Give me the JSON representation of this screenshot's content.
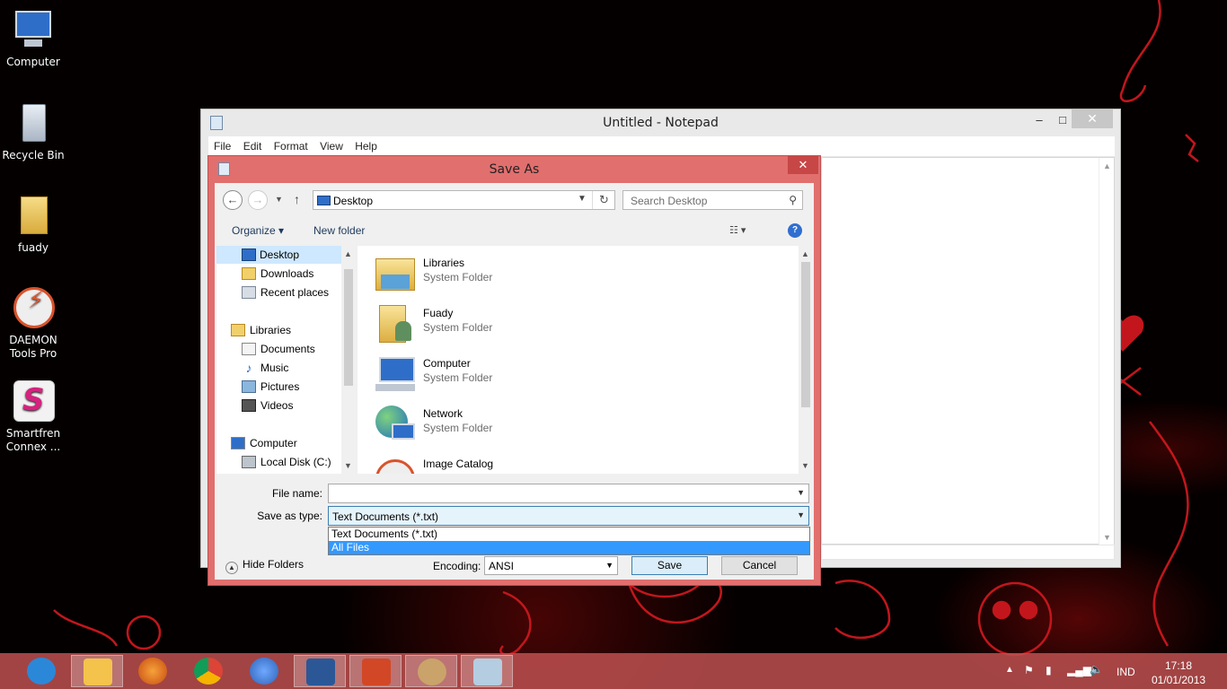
{
  "desktop": {
    "icons": [
      {
        "label": "Computer"
      },
      {
        "label": "Recycle Bin"
      },
      {
        "label": "fuady"
      },
      {
        "label": "DAEMON Tools Pro"
      },
      {
        "label": "Smartfren Connex ..."
      }
    ]
  },
  "notepad": {
    "title": "Untitled - Notepad",
    "controls": {
      "minimize": "–",
      "maximize": "□",
      "close": "✕"
    },
    "menu": [
      "File",
      "Edit",
      "Format",
      "View",
      "Help"
    ]
  },
  "save_dialog": {
    "title": "Save As",
    "close": "✕",
    "address": {
      "location": "Desktop"
    },
    "search": {
      "placeholder": "Search Desktop"
    },
    "toolbar": {
      "organize": "Organize ▾",
      "new_folder": "New folder",
      "help": "?"
    },
    "nav_pane": {
      "items": [
        {
          "label": "Desktop",
          "icon": "desktop-icon",
          "selected": true
        },
        {
          "label": "Downloads",
          "icon": "downloads-icon"
        },
        {
          "label": "Recent places",
          "icon": "recent-places-icon"
        },
        {
          "label": "Libraries",
          "icon": "libraries-icon"
        },
        {
          "label": "Documents",
          "icon": "documents-icon"
        },
        {
          "label": "Music",
          "icon": "music-icon"
        },
        {
          "label": "Pictures",
          "icon": "pictures-icon"
        },
        {
          "label": "Videos",
          "icon": "videos-icon"
        },
        {
          "label": "Computer",
          "icon": "computer-icon"
        },
        {
          "label": "Local Disk (C:)",
          "icon": "local-disk-icon"
        }
      ]
    },
    "files": [
      {
        "name": "Libraries",
        "type": "System Folder",
        "icon": "libraries-folder-icon"
      },
      {
        "name": "Fuady",
        "type": "System Folder",
        "icon": "user-folder-icon"
      },
      {
        "name": "Computer",
        "type": "System Folder",
        "icon": "computer-icon"
      },
      {
        "name": "Network",
        "type": "System Folder",
        "icon": "network-icon"
      },
      {
        "name": "Image Catalog",
        "type": "",
        "icon": "image-catalog-icon"
      }
    ],
    "file_name": {
      "label": "File name:",
      "value": ""
    },
    "save_as_type": {
      "label": "Save as type:",
      "value": "Text Documents (*.txt)",
      "options": [
        "Text Documents (*.txt)",
        "All Files"
      ],
      "highlighted": "All Files"
    },
    "hide_folders": "Hide Folders",
    "encoding": {
      "label": "Encoding:",
      "value": "ANSI"
    },
    "buttons": {
      "save": "Save",
      "cancel": "Cancel"
    }
  },
  "taskbar": {
    "apps": [
      {
        "name": "internet-explorer-icon",
        "color": "#2b88d8"
      },
      {
        "name": "file-explorer-icon",
        "color": "#f3c34b"
      },
      {
        "name": "firefox-icon",
        "color": "#e0661f"
      },
      {
        "name": "chrome-icon",
        "color": "#3f9b3f"
      },
      {
        "name": "google-earth-icon",
        "color": "#2e63b8"
      },
      {
        "name": "word-icon",
        "color": "#2b5797"
      },
      {
        "name": "powerpoint-icon",
        "color": "#d24726"
      },
      {
        "name": "paint-icon",
        "color": "#c9a36a"
      },
      {
        "name": "notepad-icon",
        "color": "#b5cde0"
      }
    ],
    "tray": {
      "language": "IND",
      "time": "17:18",
      "date": "01/01/2013"
    }
  }
}
